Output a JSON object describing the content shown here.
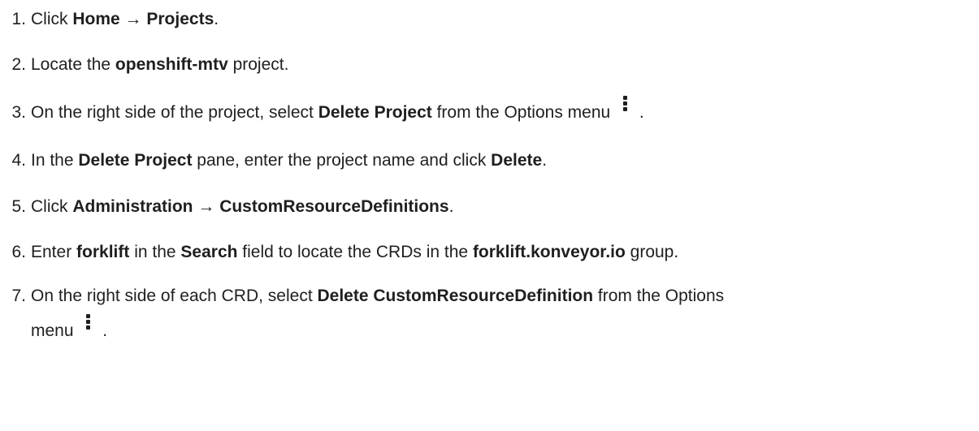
{
  "steps": [
    {
      "num": "1.",
      "a": "Click ",
      "b1": "Home",
      "arrow": " → ",
      "b2": "Projects",
      "end": "."
    },
    {
      "num": "2.",
      "a": "Locate the ",
      "b1": "openshift-mtv",
      "end": " project."
    },
    {
      "num": "3.",
      "a": "On the right side of the project, select ",
      "b1": "Delete Project",
      "mid": " from the Options menu",
      "end": "."
    },
    {
      "num": "4.",
      "a": "In the ",
      "b1": "Delete Project",
      "mid": " pane, enter the project name and click ",
      "b2": "Delete",
      "end": "."
    },
    {
      "num": "5.",
      "a": "Click ",
      "b1": "Administration",
      "arrow": " → ",
      "b2": "CustomResourceDefinitions",
      "end": "."
    },
    {
      "num": "6.",
      "a": "Enter ",
      "b1": "forklift",
      "mid": " in the ",
      "b2": "Search",
      "mid2": " field to locate the CRDs in the ",
      "b3": "forklift.konveyor.io",
      "end": " group."
    },
    {
      "num": "7.",
      "a": "On the right side of each CRD, select ",
      "b1": "Delete CustomResourceDefinition",
      "mid": " from the Options",
      "cont": "menu",
      "end": "."
    }
  ],
  "icons": {
    "options_menu": "kebab-vertical-icon"
  }
}
